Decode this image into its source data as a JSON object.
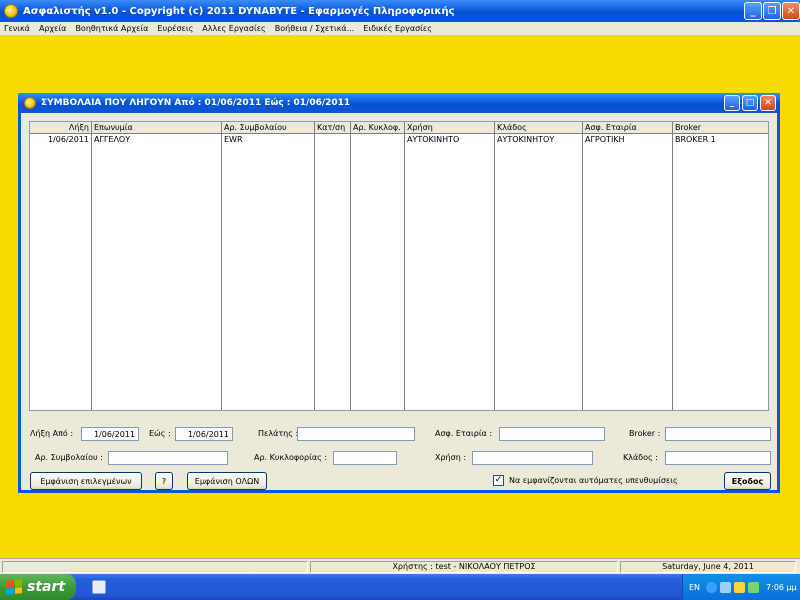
{
  "app": {
    "title": "Ασφαλιστής v1.0   -   Copyright (c) 2011 DYNABYTE - Εφαρμογές Πληροφορικής"
  },
  "menu": [
    "Γενικά",
    "Αρχεία",
    "Βοηθητικά Αρχεία",
    "Ευρέσεις",
    "Αλλες Εργασίες",
    "Βοήθεια / Σχετικά...",
    "Ειδικές Εργασίες"
  ],
  "window": {
    "title": "ΣΥΜΒΟΛΑΙΑ ΠΟΥ ΛΗΓΟΥΝ  Από : 01/06/2011  Εώς : 01/06/2011"
  },
  "grid": {
    "columns": [
      "Λήξη",
      "Επωνυμία",
      "Αρ. Συμβολαίου",
      "Κατ/ση",
      "Αρ. Κυκλοφ.",
      "Χρήση",
      "Κλάδος",
      "Ασφ. Εταιρία",
      "Broker"
    ],
    "rows": [
      [
        "1/06/2011",
        "ΑΓΓΕΛΟΥ",
        "EWR",
        "",
        "",
        "ΑΥΤΟΚΙΝΗΤΟ",
        "ΑΥΤΟΚΙΝΗΤΟΥ",
        "ΑΓΡΟΤΙΚΗ",
        "BROKER 1"
      ]
    ]
  },
  "filters": {
    "expiry_from_label": "Λήξη Από :",
    "expiry_from_value": "1/06/2011",
    "expiry_to_label": "Εώς :",
    "expiry_to_value": "1/06/2011",
    "client_label": "Πελάτης :",
    "client_value": "",
    "company_label": "Ασφ. Εταιρία :",
    "company_value": "",
    "broker_label": "Broker :",
    "broker_value": "",
    "policy_label": "Αρ. Συμβολαίου :",
    "policy_value": "",
    "plate_label": "Αρ. Κυκλοφορίας :",
    "plate_value": "",
    "usage_label": "Χρήση :",
    "usage_value": "",
    "branch_label": "Κλάδος :",
    "branch_value": ""
  },
  "buttons": {
    "show_selected": "Εμφάνιση επιλεγμένων",
    "help": "?",
    "show_all": "Εμφάνιση ΟΛΩΝ",
    "exit": "Εξοδος"
  },
  "checkbox": {
    "label": "Να εμφανίζονται αυτόματες υπενθυμίσεις",
    "checked": true,
    "mark": "✓"
  },
  "statusbar": {
    "user": "Χρήστης : test  -  ΝΙΚΟΛΑΟΥ ΠΕΤΡΟΣ",
    "date": "Saturday, June  4, 2011"
  },
  "taskbar": {
    "start": "start",
    "language": "EN",
    "time": "7:06 μμ"
  }
}
